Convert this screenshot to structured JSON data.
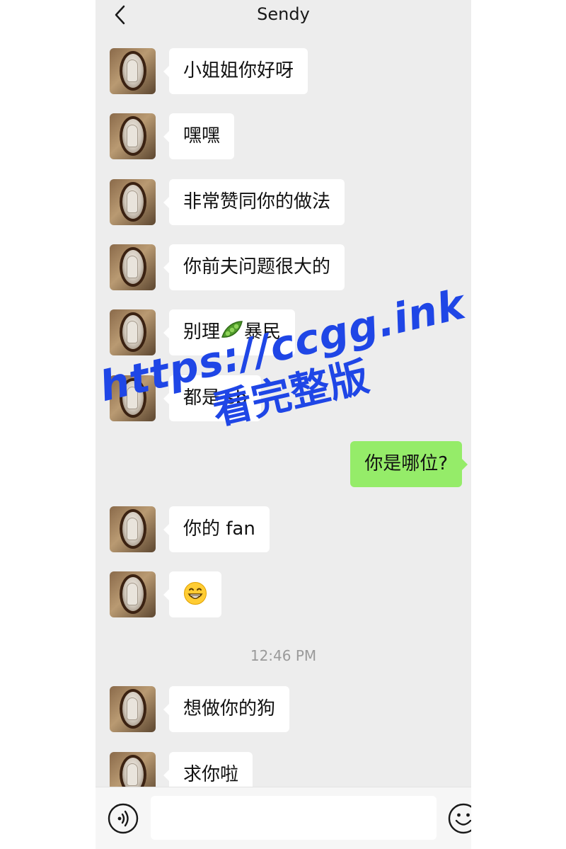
{
  "header": {
    "title": "Sendy",
    "back_icon": "chevron-left-icon"
  },
  "messages": [
    {
      "side": "left",
      "text": "小姐姐你好呀"
    },
    {
      "side": "left",
      "text": "嘿嘿"
    },
    {
      "side": "left",
      "text": "非常赞同你的做法"
    },
    {
      "side": "left",
      "text": "你前夫问题很大的"
    },
    {
      "side": "left",
      "text_before": "别理",
      "icon": "pea-pod-emoji",
      "text_after": "暴民"
    },
    {
      "side": "left",
      "text": "都是 sb"
    },
    {
      "side": "right",
      "text": "你是哪位?"
    },
    {
      "side": "left",
      "text": "你的 fan"
    },
    {
      "side": "left",
      "icon": "grinning-face-emoji"
    },
    {
      "side": "left",
      "text": "想做你的狗"
    },
    {
      "side": "left",
      "text": "求你啦"
    }
  ],
  "timestamp": "12:46 PM",
  "input": {
    "value": "",
    "voice_icon": "voice-icon",
    "emoji_icon": "emoji-icon"
  },
  "watermark": {
    "url": "https://ccgg.ink",
    "subtitle": "看完整版"
  },
  "colors": {
    "background": "#ededed",
    "incoming_bubble": "#ffffff",
    "outgoing_bubble": "#95ec69",
    "watermark": "#1f46e6"
  }
}
